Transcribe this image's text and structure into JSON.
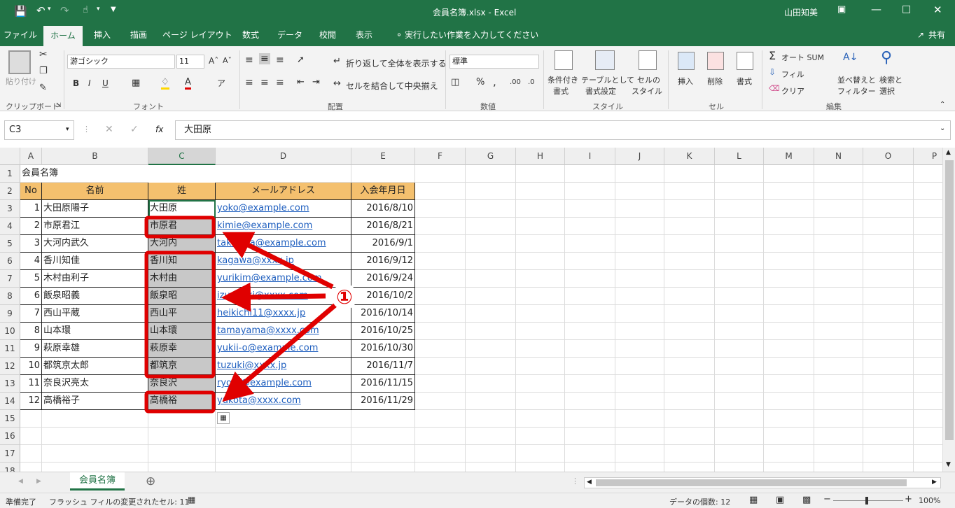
{
  "title_bar": {
    "file_title": "会員名簿.xlsx - Excel",
    "user": "山田知美"
  },
  "tabs": [
    "ファイル",
    "ホーム",
    "挿入",
    "描画",
    "ページ レイアウト",
    "数式",
    "データ",
    "校閲",
    "表示"
  ],
  "tell_me": "実行したい作業を入力してください",
  "share": "共有",
  "ribbon": {
    "clipboard": {
      "paste": "貼り付け",
      "group": "クリップボード"
    },
    "font": {
      "name": "游ゴシック",
      "size": "11",
      "bold": "B",
      "italic": "I",
      "underline": "U",
      "group": "フォント"
    },
    "alignment": {
      "wrap": "折り返して全体を表示する",
      "merge": "セルを結合して中央揃え",
      "group": "配置"
    },
    "number": {
      "format": "標準",
      "percent": "%",
      "comma": ",",
      "group": "数値"
    },
    "styles": {
      "conditional": [
        "条件付き",
        "書式"
      ],
      "table": [
        "テーブルとして",
        "書式設定"
      ],
      "cell": [
        "セルの",
        "スタイル"
      ],
      "group": "スタイル"
    },
    "cells": {
      "insert": "挿入",
      "delete": "削除",
      "format": "書式",
      "group": "セル"
    },
    "editing": {
      "autosum": "オート SUM",
      "fill": "フィル",
      "clear": "クリア",
      "sort": [
        "並べ替えと",
        "フィルター"
      ],
      "find": [
        "検索と",
        "選択"
      ],
      "group": "編集"
    }
  },
  "formula_bar": {
    "name_box": "C3",
    "fx": "fx",
    "value": "大田原"
  },
  "columns": [
    "A",
    "B",
    "C",
    "D",
    "E",
    "F",
    "G",
    "H",
    "I",
    "J",
    "K",
    "L",
    "M",
    "N",
    "O",
    "P"
  ],
  "row_numbers": [
    "1",
    "2",
    "3",
    "4",
    "5",
    "6",
    "7",
    "8",
    "9",
    "10",
    "11",
    "12",
    "13",
    "14",
    "15",
    "16",
    "17",
    "18"
  ],
  "sheet": {
    "title": "会員名簿",
    "headers": [
      "No",
      "名前",
      "姓",
      "メールアドレス",
      "入会年月日"
    ],
    "rows": [
      [
        "1",
        "大田原陽子",
        "大田原",
        "yoko@example.com",
        "2016/8/10"
      ],
      [
        "2",
        "市原君江",
        "市原君",
        "kimie@example.com",
        "2016/8/21"
      ],
      [
        "3",
        "大河内武久",
        "大河内",
        "takehisa@example.com",
        "2016/9/1"
      ],
      [
        "4",
        "香川知佳",
        "香川知",
        "kagawa@xxxx.jp",
        "2016/9/12"
      ],
      [
        "5",
        "木村由利子",
        "木村由",
        "yurikim@example.com",
        "2016/9/24"
      ],
      [
        "6",
        "飯泉昭義",
        "飯泉昭",
        "izumiaki@xxxx.com",
        "2016/10/2"
      ],
      [
        "7",
        "西山平蔵",
        "西山平",
        "heikichi11@xxxx.jp",
        "2016/10/14"
      ],
      [
        "8",
        "山本環",
        "山本環",
        "tamayama@xxxx.com",
        "2016/10/25"
      ],
      [
        "9",
        "萩原幸雄",
        "萩原幸",
        "yukii-o@example.com",
        "2016/10/30"
      ],
      [
        "10",
        "都筑京太郎",
        "都筑京",
        "tuzuki@xxxx.jp",
        "2016/11/7"
      ],
      [
        "11",
        "奈良沢亮太",
        "奈良沢",
        "ryota@example.com",
        "2016/11/15"
      ],
      [
        "12",
        "高橋裕子",
        "高橋裕",
        "yukota@xxxx.com",
        "2016/11/29"
      ]
    ]
  },
  "annotation": "①",
  "sheet_tab": "会員名簿",
  "status": {
    "ready": "準備完了",
    "flash_fill": "フラッシュ フィルの変更されたセル: 11",
    "count": "データの個数: 12",
    "zoom": "100%"
  },
  "colors": {
    "excel_green": "#217346",
    "header_fill": "#f4c06e",
    "highlight": "#e00000",
    "flash_fill_gray": "#c8c8c8"
  }
}
